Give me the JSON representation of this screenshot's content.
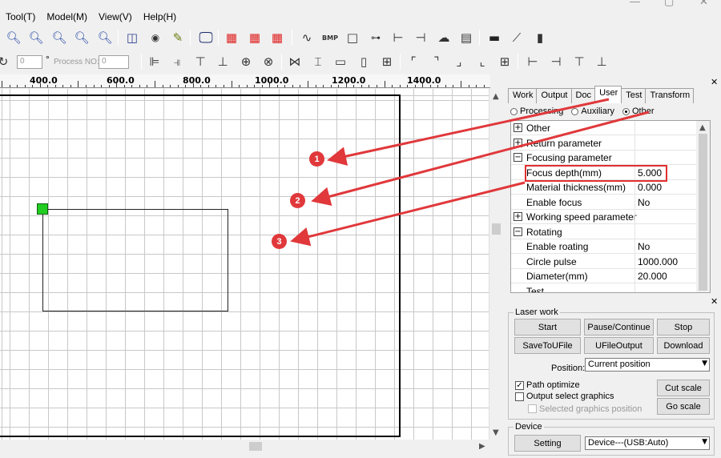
{
  "menu": [
    "Tool(T)",
    "Model(M)",
    "View(V)",
    "Help(H)"
  ],
  "toolbar1_icons": [
    "zoom-out-icon",
    "zoom-in-icon",
    "zoom-region-icon",
    "zoom-fit-icon",
    "zoom-page-icon",
    "select-rect-icon",
    "node-edit-icon",
    "pen-icon",
    "display-icon",
    "array-icon-a",
    "array-icon-b",
    "array-icon-c",
    "curve-icon",
    "bmp-icon",
    "rectangle-icon",
    "tree-icon",
    "h-size-icon",
    "v-size-icon",
    "laser-cloud-icon",
    "document-icon",
    "projector-icon",
    "magic-wand-icon",
    "ruler-bar-icon"
  ],
  "toolbar2_icons": [
    "align-left-icon",
    "align-right-icon",
    "align-top-icon",
    "align-bottom-icon",
    "align-hcenter-icon",
    "align-vcenter-icon",
    "same-width-icon",
    "same-height-icon",
    "h-spacing-icon",
    "v-spacing-icon",
    "grid-center-icon",
    "corner-tl-icon",
    "corner-tr-icon",
    "corner-br-icon",
    "corner-bl-icon",
    "center-box-icon",
    "h-line-left-icon",
    "h-line-right-icon",
    "top-align-bar-icon",
    "bottom-align-bar-icon"
  ],
  "toolbar2": {
    "angle_value": "0",
    "degree_symbol": "°",
    "process_no_label": "Process NO:",
    "process_no_value": "0"
  },
  "ruler": {
    "labels": [
      "400.0",
      "600.0",
      "800.0",
      "1000.0",
      "1200.0",
      "1400.0"
    ]
  },
  "panel": {
    "tabs": [
      "Work",
      "Output",
      "Doc",
      "User",
      "Test",
      "Transform"
    ],
    "active_tab": "User",
    "radios": [
      {
        "label": "Processing",
        "checked": false
      },
      {
        "label": "Auxiliary",
        "checked": false
      },
      {
        "label": "Other",
        "checked": true
      }
    ],
    "properties": [
      {
        "expander": "+",
        "name": "Other",
        "value": ""
      },
      {
        "expander": "+",
        "name": "Return parameter",
        "value": ""
      },
      {
        "expander": "−",
        "name": "Focusing parameter",
        "value": ""
      },
      {
        "expander": "",
        "name": "Focus depth(mm)",
        "value": "5.000"
      },
      {
        "expander": "",
        "name": "Material thickness(mm)",
        "value": "0.000"
      },
      {
        "expander": "",
        "name": "Enable focus",
        "value": "No"
      },
      {
        "expander": "+",
        "name": "Working speed parameter",
        "value": ""
      },
      {
        "expander": "−",
        "name": "Rotating",
        "value": ""
      },
      {
        "expander": "",
        "name": "Enable roating",
        "value": "No"
      },
      {
        "expander": "",
        "name": "Circle pulse",
        "value": "1000.000"
      },
      {
        "expander": "",
        "name": "Diameter(mm)",
        "value": "20.000"
      },
      {
        "expander": "",
        "name": "Test",
        "value": ""
      }
    ]
  },
  "laser_work": {
    "title": "Laser work",
    "start": "Start",
    "pause": "Pause/Continue",
    "stop": "Stop",
    "save_to_ufile": "SaveToUFile",
    "ufile_output": "UFileOutput",
    "download": "Download",
    "position_label": "Position:",
    "position_value": "Current position",
    "path_optimize": "Path optimize",
    "path_optimize_checked": true,
    "output_select": "Output select graphics",
    "selected_position": "Selected graphics position",
    "cut_scale": "Cut scale",
    "go_scale": "Go scale"
  },
  "device": {
    "title": "Device",
    "setting": "Setting",
    "device_value": "Device---(USB:Auto)"
  },
  "callouts": [
    "1",
    "2",
    "3"
  ],
  "colors": {
    "callout": "#e0383b",
    "start_marker": "#22cc22",
    "highlight": "#e03030"
  }
}
